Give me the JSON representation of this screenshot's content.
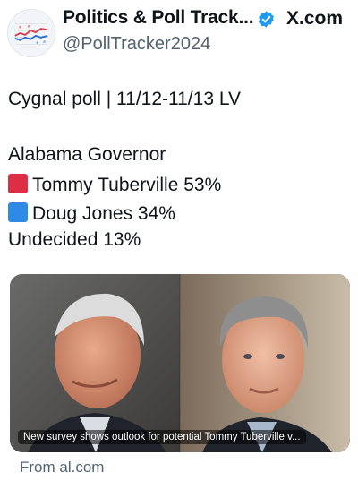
{
  "account": {
    "name": "Politics & Poll Track...",
    "handle": "@PollTracker2024",
    "site": "X.com",
    "verified_color": "#1d9bf0",
    "avatar_icon": "line-chart-avatar-icon"
  },
  "post": {
    "line1": "Cygnal poll | 11/12-11/13 LV",
    "race": "Alabama Governor",
    "candidates": [
      {
        "label": "Tommy Tuberville 53%",
        "marker": "red-square",
        "color": "#dd2e44"
      },
      {
        "label": "Doug Jones 34%",
        "marker": "blue-square",
        "color": "#2d8ae6"
      }
    ],
    "undecided": "Undecided 13%"
  },
  "link_card": {
    "caption": "New survey shows outlook for potential Tommy Tuberville v...",
    "source": "From al.com",
    "image": "two-politicians-portraits"
  }
}
